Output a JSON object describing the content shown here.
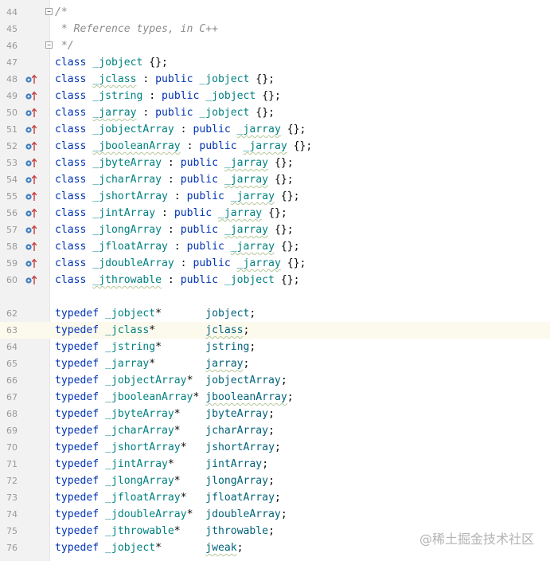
{
  "editor": {
    "lines": [
      {
        "n": "44",
        "fold": "start",
        "tokens": [
          {
            "t": "/*",
            "c": "cm"
          }
        ]
      },
      {
        "n": "45",
        "tokens": [
          {
            "t": " * Reference types, in C++",
            "c": "cm"
          }
        ]
      },
      {
        "n": "46",
        "fold": "end",
        "tokens": [
          {
            "t": " */",
            "c": "cm"
          }
        ]
      },
      {
        "n": "47",
        "tokens": [
          {
            "t": "class ",
            "c": "kw"
          },
          {
            "t": "_jobject",
            "c": "cls"
          },
          {
            "t": " {};",
            "c": "pun"
          }
        ]
      },
      {
        "n": "48",
        "mark": true,
        "tokens": [
          {
            "t": "class ",
            "c": "kw"
          },
          {
            "t": "_jclass",
            "c": "cls ul"
          },
          {
            "t": " : ",
            "c": "pun"
          },
          {
            "t": "public ",
            "c": "kw"
          },
          {
            "t": "_jobject",
            "c": "cls"
          },
          {
            "t": " {};",
            "c": "pun"
          }
        ]
      },
      {
        "n": "49",
        "mark": true,
        "tokens": [
          {
            "t": "class ",
            "c": "kw"
          },
          {
            "t": "_jstring",
            "c": "cls"
          },
          {
            "t": " : ",
            "c": "pun"
          },
          {
            "t": "public ",
            "c": "kw"
          },
          {
            "t": "_jobject",
            "c": "cls"
          },
          {
            "t": " {};",
            "c": "pun"
          }
        ]
      },
      {
        "n": "50",
        "mark": true,
        "tokens": [
          {
            "t": "class ",
            "c": "kw"
          },
          {
            "t": "_jarray",
            "c": "cls ul"
          },
          {
            "t": " : ",
            "c": "pun"
          },
          {
            "t": "public ",
            "c": "kw"
          },
          {
            "t": "_jobject",
            "c": "cls"
          },
          {
            "t": " {};",
            "c": "pun"
          }
        ]
      },
      {
        "n": "51",
        "mark": true,
        "tokens": [
          {
            "t": "class ",
            "c": "kw"
          },
          {
            "t": "_jobjectArray",
            "c": "cls"
          },
          {
            "t": " : ",
            "c": "pun"
          },
          {
            "t": "public ",
            "c": "kw"
          },
          {
            "t": "_jarray",
            "c": "cls ul"
          },
          {
            "t": " {};",
            "c": "pun"
          }
        ]
      },
      {
        "n": "52",
        "mark": true,
        "tokens": [
          {
            "t": "class ",
            "c": "kw"
          },
          {
            "t": "_jbooleanArray",
            "c": "cls ul"
          },
          {
            "t": " : ",
            "c": "pun"
          },
          {
            "t": "public ",
            "c": "kw"
          },
          {
            "t": "_jarray",
            "c": "cls ul"
          },
          {
            "t": " {};",
            "c": "pun"
          }
        ]
      },
      {
        "n": "53",
        "mark": true,
        "tokens": [
          {
            "t": "class ",
            "c": "kw"
          },
          {
            "t": "_jbyteArray",
            "c": "cls"
          },
          {
            "t": " : ",
            "c": "pun"
          },
          {
            "t": "public ",
            "c": "kw"
          },
          {
            "t": "_jarray",
            "c": "cls ul"
          },
          {
            "t": " {};",
            "c": "pun"
          }
        ]
      },
      {
        "n": "54",
        "mark": true,
        "tokens": [
          {
            "t": "class ",
            "c": "kw"
          },
          {
            "t": "_jcharArray",
            "c": "cls"
          },
          {
            "t": " : ",
            "c": "pun"
          },
          {
            "t": "public ",
            "c": "kw"
          },
          {
            "t": "_jarray",
            "c": "cls ul"
          },
          {
            "t": " {};",
            "c": "pun"
          }
        ]
      },
      {
        "n": "55",
        "mark": true,
        "tokens": [
          {
            "t": "class ",
            "c": "kw"
          },
          {
            "t": "_jshortArray",
            "c": "cls"
          },
          {
            "t": " : ",
            "c": "pun"
          },
          {
            "t": "public ",
            "c": "kw"
          },
          {
            "t": "_jarray",
            "c": "cls ul"
          },
          {
            "t": " {};",
            "c": "pun"
          }
        ]
      },
      {
        "n": "56",
        "mark": true,
        "tokens": [
          {
            "t": "class ",
            "c": "kw"
          },
          {
            "t": "_jintArray",
            "c": "cls"
          },
          {
            "t": " : ",
            "c": "pun"
          },
          {
            "t": "public ",
            "c": "kw"
          },
          {
            "t": "_jarray",
            "c": "cls ul"
          },
          {
            "t": " {};",
            "c": "pun"
          }
        ]
      },
      {
        "n": "57",
        "mark": true,
        "tokens": [
          {
            "t": "class ",
            "c": "kw"
          },
          {
            "t": "_jlongArray",
            "c": "cls"
          },
          {
            "t": " : ",
            "c": "pun"
          },
          {
            "t": "public ",
            "c": "kw"
          },
          {
            "t": "_jarray",
            "c": "cls ul"
          },
          {
            "t": " {};",
            "c": "pun"
          }
        ]
      },
      {
        "n": "58",
        "mark": true,
        "tokens": [
          {
            "t": "class ",
            "c": "kw"
          },
          {
            "t": "_jfloatArray",
            "c": "cls"
          },
          {
            "t": " : ",
            "c": "pun"
          },
          {
            "t": "public ",
            "c": "kw"
          },
          {
            "t": "_jarray",
            "c": "cls ul"
          },
          {
            "t": " {};",
            "c": "pun"
          }
        ]
      },
      {
        "n": "59",
        "mark": true,
        "tokens": [
          {
            "t": "class ",
            "c": "kw"
          },
          {
            "t": "_jdoubleArray",
            "c": "cls"
          },
          {
            "t": " : ",
            "c": "pun"
          },
          {
            "t": "public ",
            "c": "kw"
          },
          {
            "t": "_jarray",
            "c": "cls ul"
          },
          {
            "t": " {};",
            "c": "pun"
          }
        ]
      },
      {
        "n": "60",
        "mark": true,
        "tokens": [
          {
            "t": "class ",
            "c": "kw"
          },
          {
            "t": "_jthrowable",
            "c": "cls ul"
          },
          {
            "t": " : ",
            "c": "pun"
          },
          {
            "t": "public ",
            "c": "kw"
          },
          {
            "t": "_jobject",
            "c": "cls"
          },
          {
            "t": " {};",
            "c": "pun"
          }
        ]
      },
      {
        "n": "",
        "tokens": []
      },
      {
        "n": "62",
        "tokens": [
          {
            "t": "typedef ",
            "c": "kw"
          },
          {
            "t": "_jobject",
            "c": "cls"
          },
          {
            "t": "*       ",
            "c": "pun"
          },
          {
            "t": "jobject",
            "c": "td"
          },
          {
            "t": ";",
            "c": "pun"
          }
        ]
      },
      {
        "n": "63",
        "current": true,
        "tokens": [
          {
            "t": "typedef ",
            "c": "kw"
          },
          {
            "t": "_jclass",
            "c": "cls"
          },
          {
            "t": "*        ",
            "c": "pun"
          },
          {
            "t": "jclass",
            "c": "td ul"
          },
          {
            "t": ";",
            "c": "pun"
          }
        ]
      },
      {
        "n": "64",
        "tokens": [
          {
            "t": "typedef ",
            "c": "kw"
          },
          {
            "t": "_jstring",
            "c": "cls"
          },
          {
            "t": "*       ",
            "c": "pun"
          },
          {
            "t": "jstring",
            "c": "td"
          },
          {
            "t": ";",
            "c": "pun"
          }
        ]
      },
      {
        "n": "65",
        "tokens": [
          {
            "t": "typedef ",
            "c": "kw"
          },
          {
            "t": "_jarray",
            "c": "cls"
          },
          {
            "t": "*        ",
            "c": "pun"
          },
          {
            "t": "jarray",
            "c": "td ul"
          },
          {
            "t": ";",
            "c": "pun"
          }
        ]
      },
      {
        "n": "66",
        "tokens": [
          {
            "t": "typedef ",
            "c": "kw"
          },
          {
            "t": "_jobjectArray",
            "c": "cls"
          },
          {
            "t": "*  ",
            "c": "pun"
          },
          {
            "t": "jobjectArray",
            "c": "td"
          },
          {
            "t": ";",
            "c": "pun"
          }
        ]
      },
      {
        "n": "67",
        "tokens": [
          {
            "t": "typedef ",
            "c": "kw"
          },
          {
            "t": "_jbooleanArray",
            "c": "cls"
          },
          {
            "t": "* ",
            "c": "pun"
          },
          {
            "t": "jbooleanArray",
            "c": "td ul"
          },
          {
            "t": ";",
            "c": "pun"
          }
        ]
      },
      {
        "n": "68",
        "tokens": [
          {
            "t": "typedef ",
            "c": "kw"
          },
          {
            "t": "_jbyteArray",
            "c": "cls"
          },
          {
            "t": "*    ",
            "c": "pun"
          },
          {
            "t": "jbyteArray",
            "c": "td"
          },
          {
            "t": ";",
            "c": "pun"
          }
        ]
      },
      {
        "n": "69",
        "tokens": [
          {
            "t": "typedef ",
            "c": "kw"
          },
          {
            "t": "_jcharArray",
            "c": "cls"
          },
          {
            "t": "*    ",
            "c": "pun"
          },
          {
            "t": "jcharArray",
            "c": "td"
          },
          {
            "t": ";",
            "c": "pun"
          }
        ]
      },
      {
        "n": "70",
        "tokens": [
          {
            "t": "typedef ",
            "c": "kw"
          },
          {
            "t": "_jshortArray",
            "c": "cls"
          },
          {
            "t": "*   ",
            "c": "pun"
          },
          {
            "t": "jshortArray",
            "c": "td"
          },
          {
            "t": ";",
            "c": "pun"
          }
        ]
      },
      {
        "n": "71",
        "tokens": [
          {
            "t": "typedef ",
            "c": "kw"
          },
          {
            "t": "_jintArray",
            "c": "cls"
          },
          {
            "t": "*     ",
            "c": "pun"
          },
          {
            "t": "jintArray",
            "c": "td"
          },
          {
            "t": ";",
            "c": "pun"
          }
        ]
      },
      {
        "n": "72",
        "tokens": [
          {
            "t": "typedef ",
            "c": "kw"
          },
          {
            "t": "_jlongArray",
            "c": "cls"
          },
          {
            "t": "*    ",
            "c": "pun"
          },
          {
            "t": "jlongArray",
            "c": "td"
          },
          {
            "t": ";",
            "c": "pun"
          }
        ]
      },
      {
        "n": "73",
        "tokens": [
          {
            "t": "typedef ",
            "c": "kw"
          },
          {
            "t": "_jfloatArray",
            "c": "cls"
          },
          {
            "t": "*   ",
            "c": "pun"
          },
          {
            "t": "jfloatArray",
            "c": "td"
          },
          {
            "t": ";",
            "c": "pun"
          }
        ]
      },
      {
        "n": "74",
        "tokens": [
          {
            "t": "typedef ",
            "c": "kw"
          },
          {
            "t": "_jdoubleArray",
            "c": "cls"
          },
          {
            "t": "*  ",
            "c": "pun"
          },
          {
            "t": "jdoubleArray",
            "c": "td"
          },
          {
            "t": ";",
            "c": "pun"
          }
        ]
      },
      {
        "n": "75",
        "tokens": [
          {
            "t": "typedef ",
            "c": "kw"
          },
          {
            "t": "_jthrowable",
            "c": "cls"
          },
          {
            "t": "*    ",
            "c": "pun"
          },
          {
            "t": "jthrowable",
            "c": "td"
          },
          {
            "t": ";",
            "c": "pun"
          }
        ]
      },
      {
        "n": "76",
        "tokens": [
          {
            "t": "typedef ",
            "c": "kw"
          },
          {
            "t": "_jobject",
            "c": "cls"
          },
          {
            "t": "*       ",
            "c": "pun"
          },
          {
            "t": "jweak",
            "c": "td ul"
          },
          {
            "t": ";",
            "c": "pun"
          }
        ]
      }
    ]
  },
  "icons": {
    "mark": "implemented-up-arrow-icon",
    "fold": "fold-marker-icon"
  },
  "colors": {
    "keyword": "#0033b3",
    "class_name": "#008080",
    "typedef_name": "#00627a",
    "comment": "#8c8c8c",
    "gutter_mark_dot": "#3c7ebf",
    "gutter_mark_arrow": "#c73d3d",
    "current_line": "#fcfaed"
  },
  "watermark": {
    "text": "@稀土掘金技术社区"
  }
}
